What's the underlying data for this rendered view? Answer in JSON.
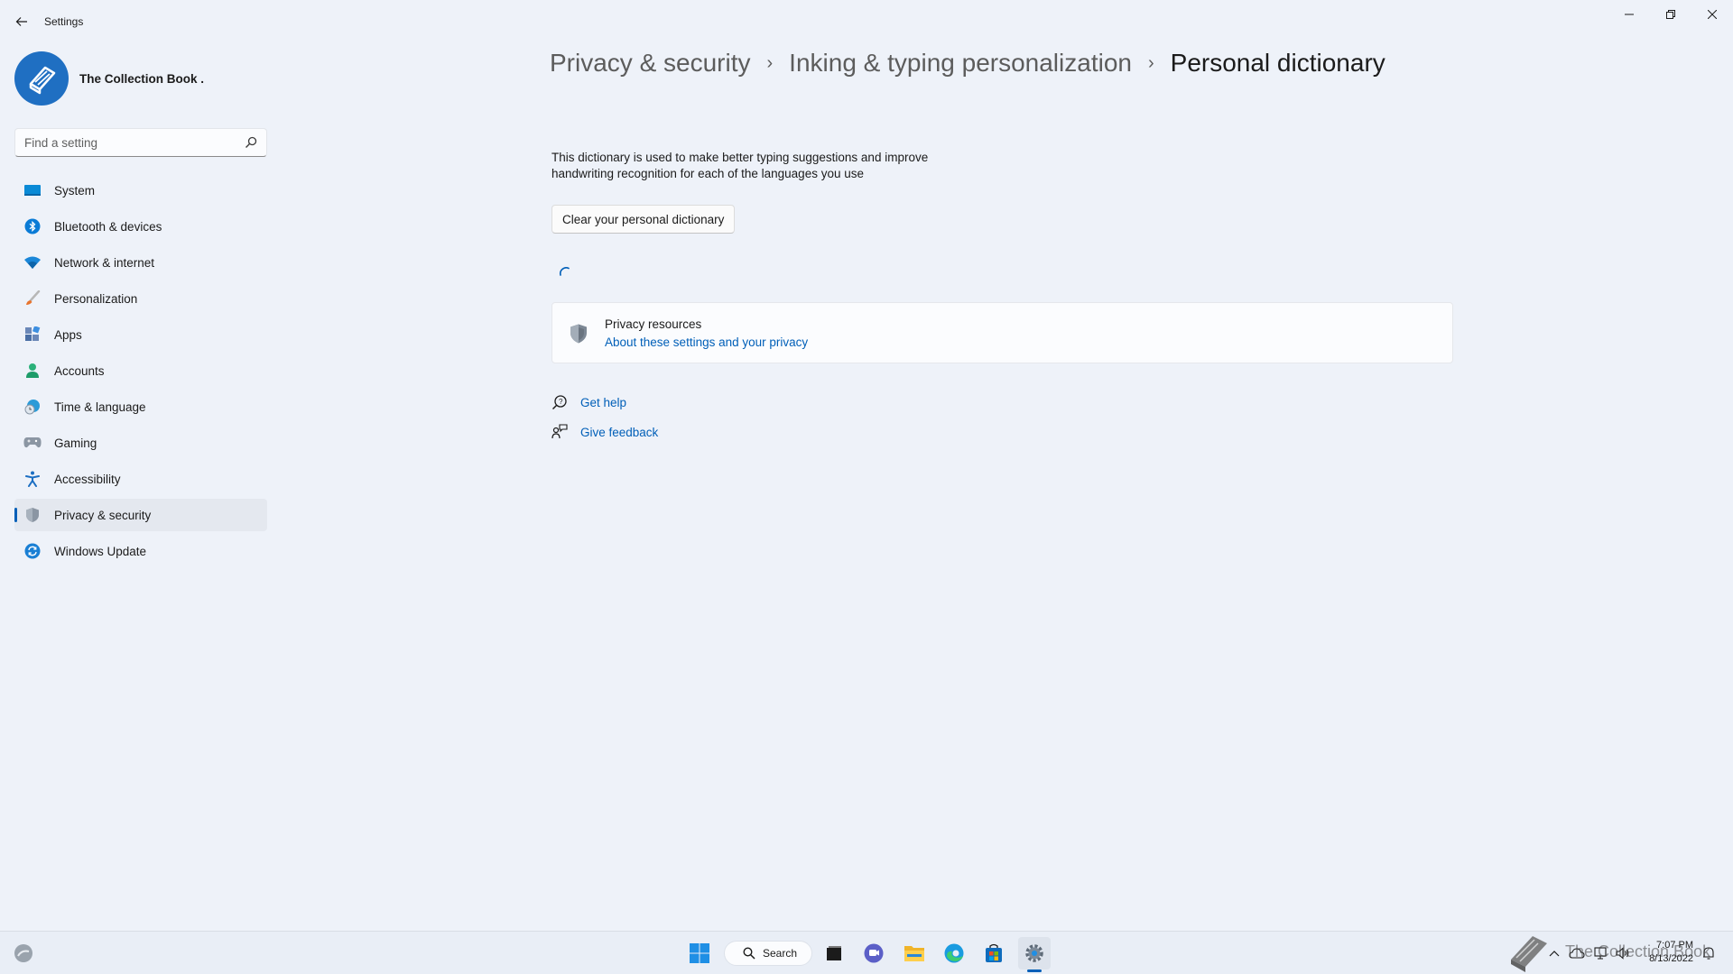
{
  "window": {
    "app_title": "Settings",
    "controls": [
      "minimize",
      "restore",
      "close"
    ]
  },
  "profile": {
    "name": "The Collection Book ."
  },
  "search": {
    "placeholder": "Find a setting"
  },
  "sidebar": {
    "items": [
      {
        "label": "System",
        "icon": "system-icon",
        "selected": false
      },
      {
        "label": "Bluetooth & devices",
        "icon": "bluetooth-icon",
        "selected": false
      },
      {
        "label": "Network & internet",
        "icon": "wifi-icon",
        "selected": false
      },
      {
        "label": "Personalization",
        "icon": "brush-icon",
        "selected": false
      },
      {
        "label": "Apps",
        "icon": "apps-icon",
        "selected": false
      },
      {
        "label": "Accounts",
        "icon": "person-icon",
        "selected": false
      },
      {
        "label": "Time & language",
        "icon": "globe-clock-icon",
        "selected": false
      },
      {
        "label": "Gaming",
        "icon": "gamepad-icon",
        "selected": false
      },
      {
        "label": "Accessibility",
        "icon": "accessibility-icon",
        "selected": false
      },
      {
        "label": "Privacy & security",
        "icon": "shield-icon",
        "selected": true
      },
      {
        "label": "Windows Update",
        "icon": "update-icon",
        "selected": false
      }
    ]
  },
  "breadcrumb": {
    "items": [
      "Privacy & security",
      "Inking & typing personalization",
      "Personal dictionary"
    ],
    "separator": "›"
  },
  "main": {
    "description": "This dictionary is used to make better typing suggestions and improve handwriting recognition for each of the languages you use",
    "clear_button": "Clear your personal dictionary",
    "privacy_card": {
      "title": "Privacy resources",
      "link": "About these settings and your privacy"
    },
    "help": {
      "get_help": "Get help",
      "give_feedback": "Give feedback"
    }
  },
  "taskbar": {
    "search_label": "Search",
    "pinned": [
      "start-icon",
      "search",
      "task-view-icon",
      "teams-chat-icon",
      "file-explorer-icon",
      "edge-icon",
      "store-icon",
      "settings-icon"
    ],
    "time": "7:07 PM",
    "date": "8/13/2022",
    "watermark": "The Collection Book"
  },
  "colors": {
    "accent": "#005fb8",
    "background": "#eef2f9",
    "selected_nav": "#e4e8ef",
    "link": "#005fb8"
  }
}
